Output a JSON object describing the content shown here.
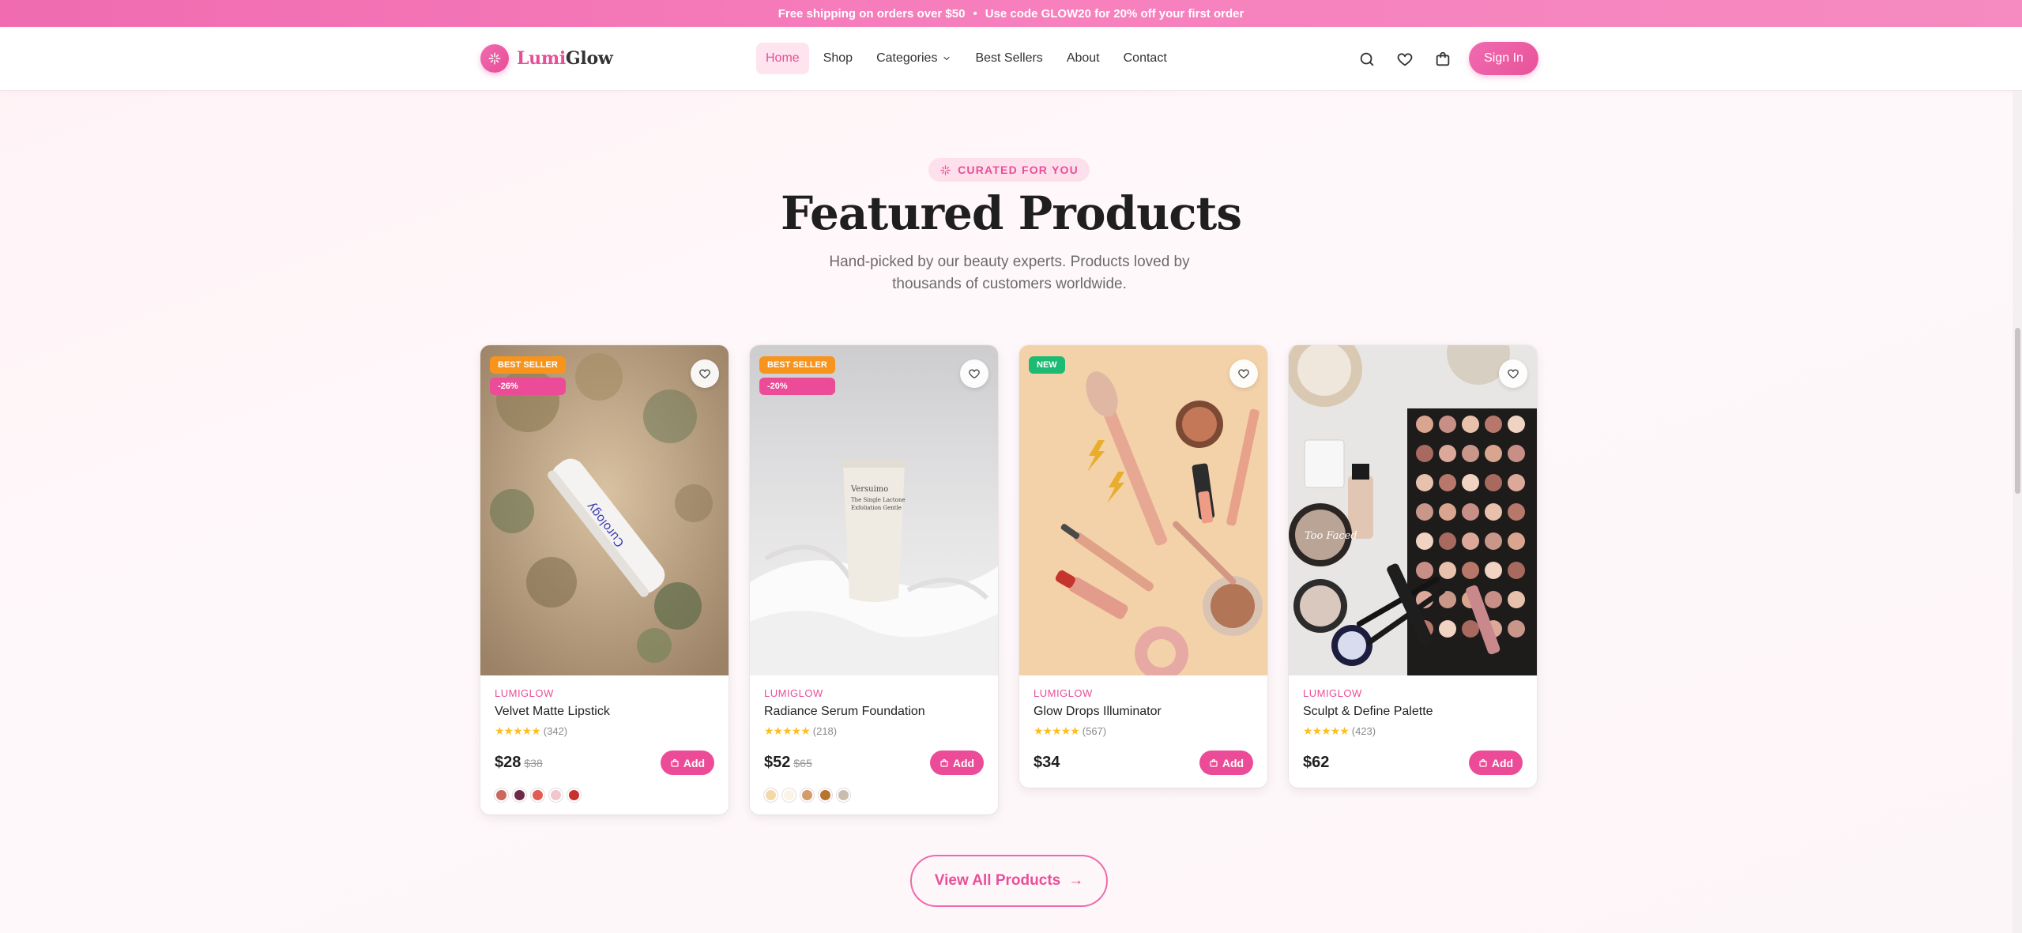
{
  "promo": {
    "part1": "Free shipping on orders over $50",
    "separator": "•",
    "part2_before": "Use code",
    "code": "GLOW20",
    "part2_after": "for 20% off your first order"
  },
  "header": {
    "logo_primary": "Lumi",
    "logo_secondary": "Glow",
    "nav": [
      {
        "label": "Home",
        "active": true
      },
      {
        "label": "Shop"
      },
      {
        "label": "Categories",
        "has_dropdown": true
      },
      {
        "label": "Best Sellers"
      },
      {
        "label": "About"
      },
      {
        "label": "Contact"
      }
    ],
    "icons": [
      "search-icon",
      "heart-icon",
      "shopping-bag-icon"
    ],
    "signin_label": "Sign In"
  },
  "section": {
    "eyebrow": "CURATED FOR YOU",
    "title": "Featured Products",
    "subtitle": "Hand-picked by our beauty experts. Products loved by thousands of customers worldwide."
  },
  "products": [
    {
      "badges": [
        "BEST SELLER",
        "-26%"
      ],
      "brand": "LUMIGLOW",
      "name": "Velvet Matte Lipstick",
      "rating_count": "(342)",
      "price": "$28",
      "old_price": "$38",
      "add_label": "Add",
      "swatches": [
        "#c96a5f",
        "#6d2a46",
        "#e15c53",
        "#f1c6cf",
        "#c7302c"
      ]
    },
    {
      "badges": [
        "BEST SELLER",
        "-20%"
      ],
      "brand": "LUMIGLOW",
      "name": "Radiance Serum Foundation",
      "rating_count": "(218)",
      "price": "$52",
      "old_price": "$65",
      "add_label": "Add",
      "swatches": [
        "#f4d9a8",
        "#fbf3e6",
        "#d49a6a",
        "#b8742e",
        "#cbbcae"
      ]
    },
    {
      "badges": [
        "NEW"
      ],
      "brand": "LUMIGLOW",
      "name": "Glow Drops Illuminator",
      "rating_count": "(567)",
      "price": "$34",
      "old_price": "",
      "add_label": "Add",
      "swatches": []
    },
    {
      "badges": [],
      "brand": "LUMIGLOW",
      "name": "Sculpt & Define Palette",
      "rating_count": "(423)",
      "price": "$62",
      "old_price": "",
      "add_label": "Add",
      "swatches": []
    }
  ],
  "cta": {
    "label": "View All Products",
    "arrow": "→"
  },
  "colors": {
    "accent": "#e94e98",
    "best_seller": "#f7941d",
    "new": "#1dba73",
    "star": "#fbbf24"
  }
}
